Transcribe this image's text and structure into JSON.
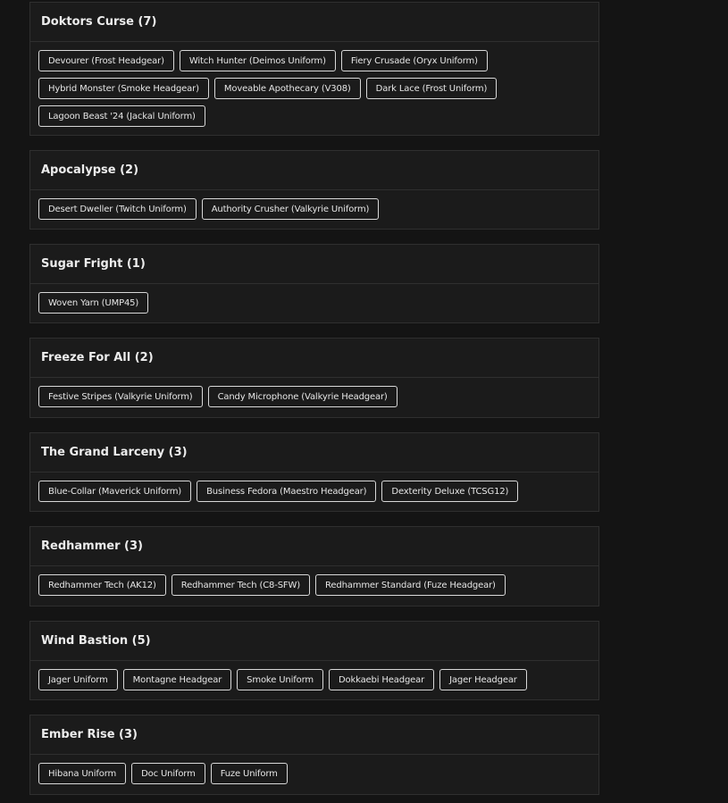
{
  "events": [
    {
      "title": "Doktors Curse (7)",
      "items": [
        "Devourer (Frost Headgear)",
        "Witch Hunter (Deimos Uniform)",
        "Fiery Crusade (Oryx Uniform)",
        "Hybrid Monster (Smoke Headgear)",
        "Moveable Apothecary (V308)",
        "Dark Lace (Frost Uniform)",
        "Lagoon Beast '24 (Jackal Uniform)"
      ]
    },
    {
      "title": "Apocalypse (2)",
      "items": [
        "Desert Dweller (Twitch Uniform)",
        "Authority Crusher (Valkyrie Uniform)"
      ]
    },
    {
      "title": "Sugar Fright (1)",
      "items": [
        "Woven Yarn (UMP45)"
      ]
    },
    {
      "title": "Freeze For All (2)",
      "items": [
        "Festive Stripes (Valkyrie Uniform)",
        "Candy Microphone (Valkyrie Headgear)"
      ]
    },
    {
      "title": "The Grand Larceny (3)",
      "items": [
        "Blue-Collar (Maverick Uniform)",
        "Business Fedora (Maestro Headgear)",
        "Dexterity Deluxe (TCSG12)"
      ]
    },
    {
      "title": "Redhammer (3)",
      "items": [
        "Redhammer Tech (AK12)",
        "Redhammer Tech (C8-SFW)",
        "Redhammer Standard (Fuze Headgear)"
      ]
    },
    {
      "title": "Wind Bastion (5)",
      "items": [
        "Jager Uniform",
        "Montagne Headgear",
        "Smoke Uniform",
        "Dokkaebi Headgear",
        "Jager Headgear"
      ]
    },
    {
      "title": "Ember Rise (3)",
      "items": [
        "Hibana Uniform",
        "Doc Uniform",
        "Fuze Uniform"
      ]
    }
  ]
}
